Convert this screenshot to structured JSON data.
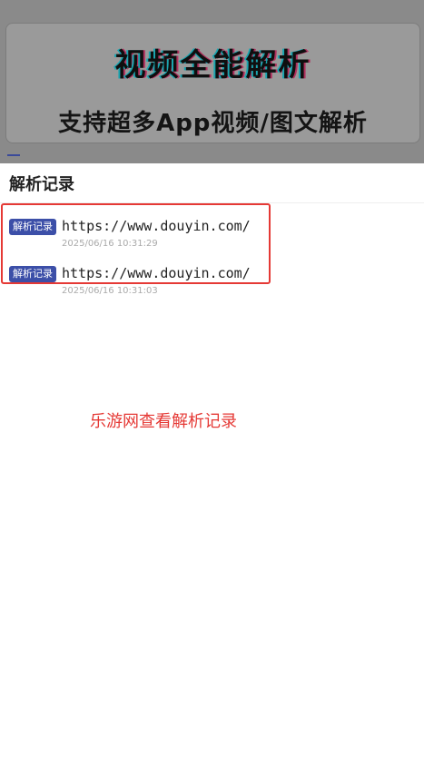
{
  "banner": {
    "title": "视频全能解析",
    "subtitle": "支持超多App视频/图文解析"
  },
  "sheet": {
    "title": "解析记录",
    "records": [
      {
        "tag": "解析记录",
        "url": "https://www.douyin.com/",
        "time": "2025/06/16 10:31:29"
      },
      {
        "tag": "解析记录",
        "url": "https://www.douyin.com/",
        "time": "2025/06/16 10:31:03"
      }
    ]
  },
  "caption": "乐游网查看解析记录",
  "colors": {
    "accent": "#3c4fa8",
    "highlight": "#e53935",
    "overlay": "#8a8a8a"
  }
}
